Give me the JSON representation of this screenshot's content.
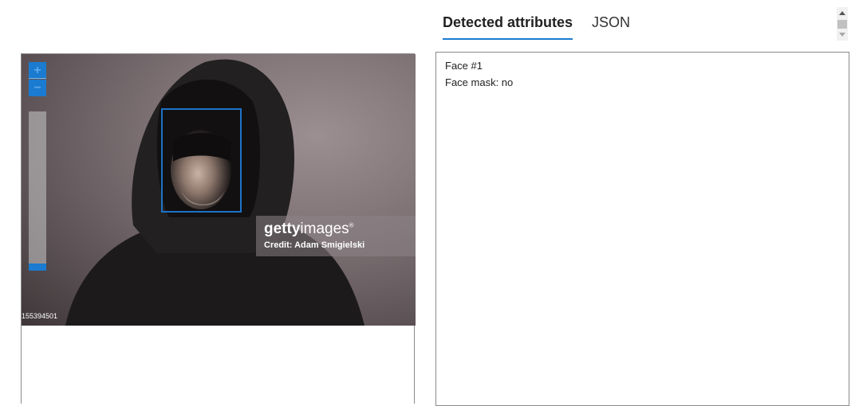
{
  "tabs": [
    {
      "label": "Detected attributes",
      "active": true
    },
    {
      "label": "JSON",
      "active": false
    }
  ],
  "viewer": {
    "zoom_in_label": "+",
    "zoom_out_label": "−",
    "zoom_level": 0,
    "watermark_logo_bold": "getty",
    "watermark_logo_rest": "images",
    "watermark_logo_mark": "®",
    "watermark_credit": "Credit: Adam Smigielski",
    "image_id": "155394501"
  },
  "attributes": [
    "Face #1",
    "Face mask: no"
  ],
  "colors": {
    "accent": "#1a7bd0",
    "face_box": "#1d73c9"
  },
  "icons": {
    "zoom_in": "plus-icon",
    "zoom_out": "minus-icon",
    "scroll_up": "caret-up-icon",
    "scroll_down": "caret-down-icon"
  }
}
